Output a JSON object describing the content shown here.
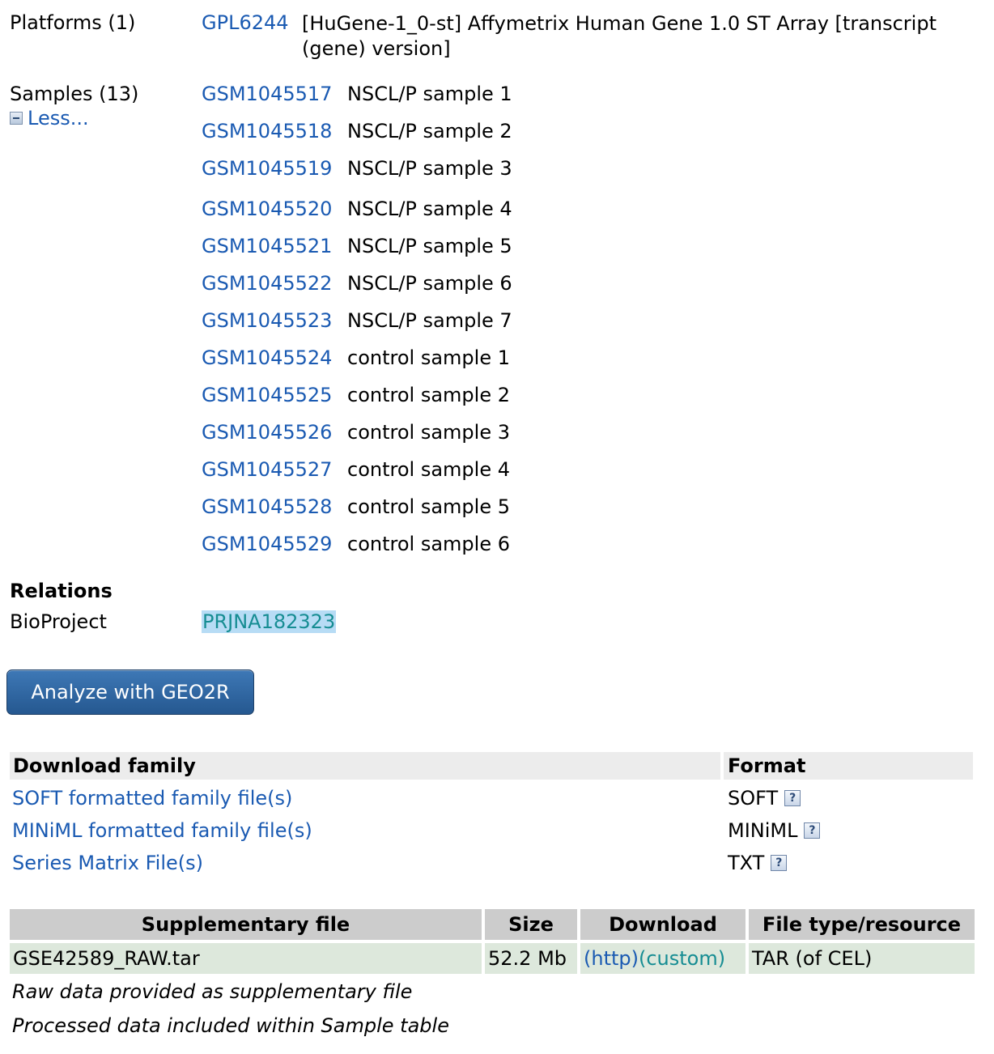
{
  "platforms": {
    "label": "Platforms (1)",
    "items": [
      {
        "id": "GPL6244",
        "description": "[HuGene-1_0-st] Affymetrix Human Gene 1.0 ST Array [transcript (gene) version]"
      }
    ]
  },
  "samples": {
    "label": "Samples (13)",
    "toggle_label": "Less...",
    "items": [
      {
        "id": "GSM1045517",
        "description": "NSCL/P sample 1"
      },
      {
        "id": "GSM1045518",
        "description": "NSCL/P sample 2"
      },
      {
        "id": "GSM1045519",
        "description": "NSCL/P sample 3"
      },
      {
        "id": "GSM1045520",
        "description": "NSCL/P sample 4"
      },
      {
        "id": "GSM1045521",
        "description": "NSCL/P sample 5"
      },
      {
        "id": "GSM1045522",
        "description": "NSCL/P sample 6"
      },
      {
        "id": "GSM1045523",
        "description": "NSCL/P sample 7"
      },
      {
        "id": "GSM1045524",
        "description": "control sample 1"
      },
      {
        "id": "GSM1045525",
        "description": "control sample 2"
      },
      {
        "id": "GSM1045526",
        "description": "control sample 3"
      },
      {
        "id": "GSM1045527",
        "description": "control sample 4"
      },
      {
        "id": "GSM1045528",
        "description": "control sample 5"
      },
      {
        "id": "GSM1045529",
        "description": "control sample 6"
      }
    ]
  },
  "relations": {
    "heading": "Relations",
    "bioproject_label": "BioProject",
    "bioproject_id": "PRJNA182323"
  },
  "geo2r_button": "Analyze with GEO2R",
  "download_family": {
    "header_family": "Download family",
    "header_format": "Format",
    "rows": [
      {
        "label": "SOFT formatted family file(s)",
        "format": "SOFT"
      },
      {
        "label": "MINiML formatted family file(s)",
        "format": "MINiML"
      },
      {
        "label": "Series Matrix File(s)",
        "format": "TXT"
      }
    ],
    "help_icon": "?"
  },
  "supplementary": {
    "headers": [
      "Supplementary file",
      "Size",
      "Download",
      "File type/resource"
    ],
    "row": {
      "file": "GSE42589_RAW.tar",
      "size": "52.2 Mb",
      "http": "(http)",
      "custom": "(custom)",
      "type": "TAR (of CEL)"
    },
    "notes": [
      "Raw data provided as supplementary file",
      "Processed data included within Sample table"
    ]
  },
  "colors": {
    "link": "#1a5ab2",
    "visited_link": "#168d93",
    "button_blue": "#2f67a3",
    "table_header": "#cccccc",
    "table_row": "#dde8dc"
  }
}
